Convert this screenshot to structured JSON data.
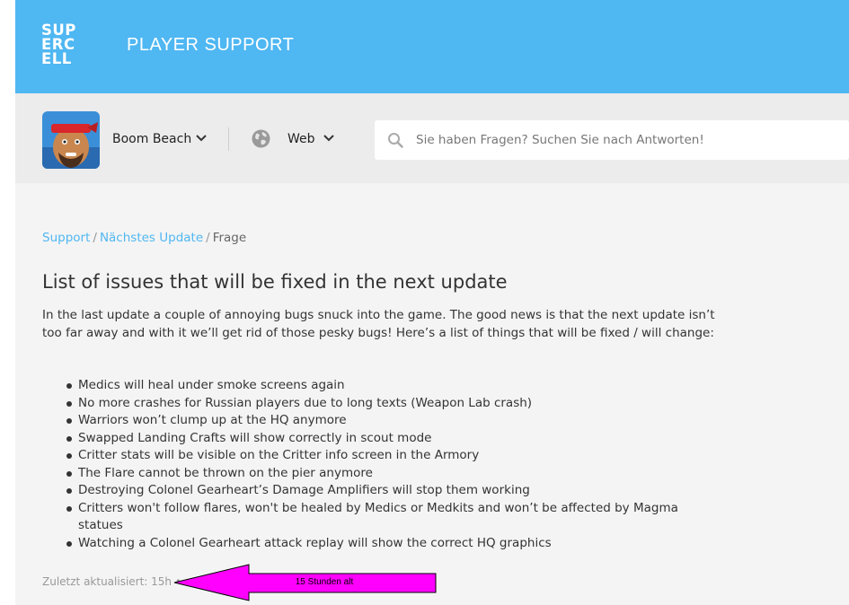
{
  "header": {
    "logo_lines": [
      "SUP",
      "ERC",
      "ELL"
    ],
    "title": "PLAYER SUPPORT",
    "brand_color": "#4fb7f2"
  },
  "nav": {
    "game": {
      "name": "Boom Beach",
      "icon": "boom-beach-game-icon"
    },
    "platform": {
      "name": "Web",
      "icon": "globe-icon"
    },
    "search": {
      "placeholder": "Sie haben Fragen? Suchen Sie nach Antworten!",
      "value": "",
      "icon": "search-icon"
    }
  },
  "breadcrumb": {
    "items": [
      "Support",
      "Nächstes Update"
    ],
    "separator": "/",
    "current": "Frage"
  },
  "article": {
    "title": "List of issues that will be fixed in the next update",
    "intro": "In the last update a couple of annoying bugs snuck into the game. The good news is that the next update isn’t too far away and with it we’ll get rid of those pesky bugs! Here’s a list of things that will be fixed / will change:",
    "issues": [
      "Medics will heal under smoke screens again",
      "No more crashes for Russian players due to long texts (Weapon Lab crash)",
      "Warriors won’t clump up at the HQ anymore",
      "Swapped Landing Crafts will show correctly in scout mode",
      "Critter stats will be visible on the Critter info screen in the Armory",
      "The Flare cannot be thrown on the pier anymore",
      "Destroying Colonel Gearheart’s Damage Amplifiers will stop them working",
      "Critters won't follow flares, won't be healed by Medics or Medkits and won’t be affected by Magma statues",
      "Watching a Colonel Gearheart attack replay will show the correct HQ graphics"
    ],
    "last_updated": "Zuletzt aktualisiert: 15h •"
  },
  "annotation": {
    "label": "15 Stunden alt",
    "color": "#ff00ff"
  }
}
